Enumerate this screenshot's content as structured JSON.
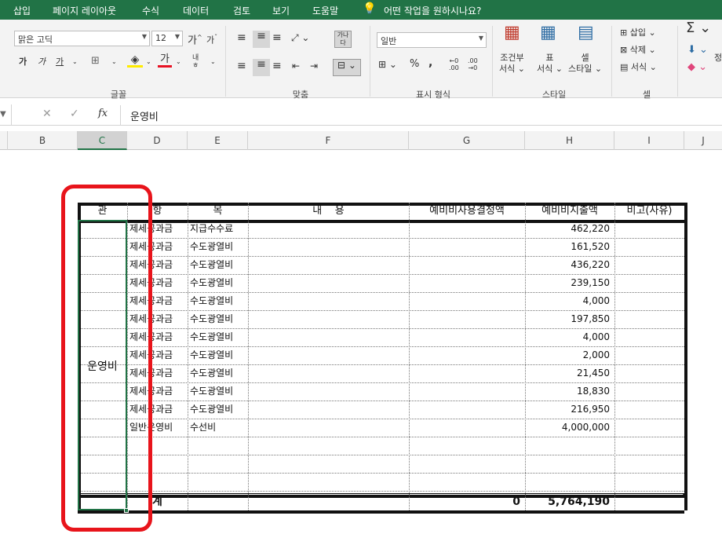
{
  "menu": {
    "items": [
      "삽입",
      "페이지 레이아웃",
      "수식",
      "데이터",
      "검토",
      "보기",
      "도움말"
    ],
    "tell_me": "어떤 작업을 원하시나요?"
  },
  "ribbon": {
    "font": {
      "name": "맑은 고딕",
      "size": "12",
      "group_label": "글꼴"
    },
    "align": {
      "group_label": "맞춤"
    },
    "number": {
      "format": "일반",
      "group_label": "표시 형식"
    },
    "styles": {
      "conditional_1": "조건부",
      "conditional_2": "서식",
      "table_1": "표",
      "table_2": "서식",
      "cell_1": "셀",
      "cell_2": "스타일",
      "group_label": "스타일"
    },
    "cells": {
      "insert": "삽입",
      "delete": "삭제",
      "format": "서식",
      "group_label": "셀"
    }
  },
  "formula_bar": {
    "value": "운영비",
    "fx": "fx"
  },
  "columns": [
    "B",
    "C",
    "D",
    "E",
    "F",
    "G",
    "H",
    "I",
    "J"
  ],
  "table": {
    "headers": {
      "gwan": "관",
      "hang": "항",
      "mok": "목",
      "content": "내    용",
      "decided": "예비비사용결정액",
      "spent": "예비비지출액",
      "note": "비고(사유)"
    },
    "merged_gwan": "운영비",
    "rows": [
      {
        "hang": "제세공과금",
        "mok": "지급수수료",
        "spent": "462,220"
      },
      {
        "hang": "제세공과금",
        "mok": "수도광열비",
        "spent": "161,520"
      },
      {
        "hang": "제세공과금",
        "mok": "수도광열비",
        "spent": "436,220"
      },
      {
        "hang": "제세공과금",
        "mok": "수도광열비",
        "spent": "239,150"
      },
      {
        "hang": "제세공과금",
        "mok": "수도광열비",
        "spent": "4,000"
      },
      {
        "hang": "제세공과금",
        "mok": "수도광열비",
        "spent": "197,850"
      },
      {
        "hang": "제세공과금",
        "mok": "수도광열비",
        "spent": "4,000"
      },
      {
        "hang": "제세공과금",
        "mok": "수도광열비",
        "spent": "2,000"
      },
      {
        "hang": "제세공과금",
        "mok": "수도광열비",
        "spent": "21,450"
      },
      {
        "hang": "제세공과금",
        "mok": "수도광열비",
        "spent": "18,830"
      },
      {
        "hang": "제세공과금",
        "mok": "수도광열비",
        "spent": "216,950"
      },
      {
        "hang": "일반운영비",
        "mok": "수선비",
        "spent": "4,000,000"
      },
      {
        "hang": "",
        "mok": "",
        "spent": ""
      },
      {
        "hang": "",
        "mok": "",
        "spent": ""
      },
      {
        "hang": "",
        "mok": "",
        "spent": ""
      }
    ],
    "total": {
      "label": "계",
      "decided": "0",
      "spent": "5,764,190"
    }
  },
  "colors": {
    "excel_green": "#217346",
    "annotation_red": "#e8141b"
  }
}
